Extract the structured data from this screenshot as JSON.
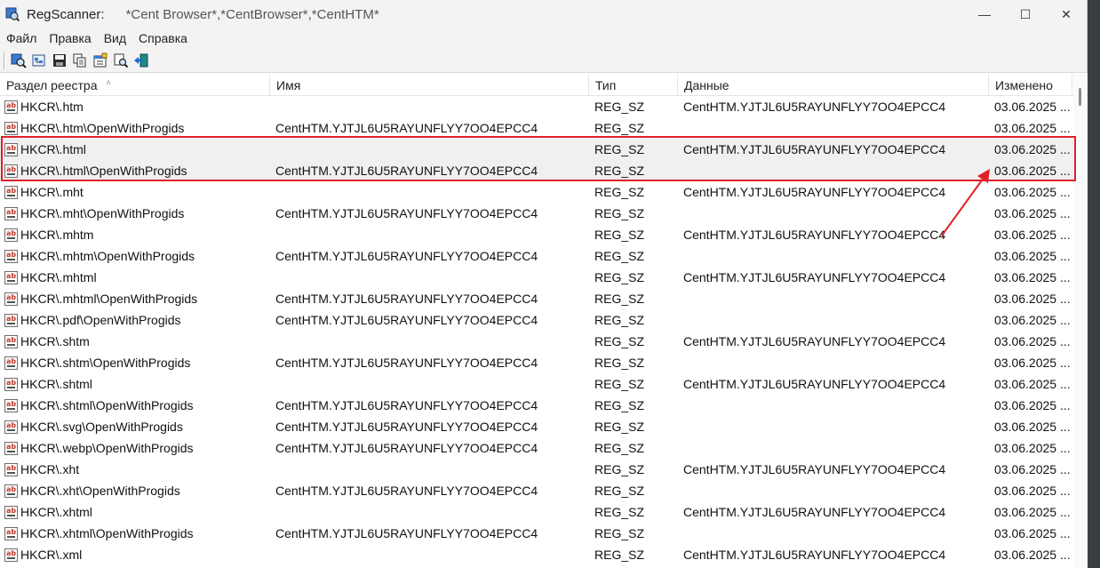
{
  "window": {
    "app_name": "RegScanner:",
    "filter": "*Cent Browser*,*CentBrowser*,*CentHTM*",
    "minimize": "—",
    "maximize": "☐",
    "close": "✕"
  },
  "menu": [
    "Файл",
    "Правка",
    "Вид",
    "Справка"
  ],
  "columns": {
    "key": "Раздел реестра",
    "name": "Имя",
    "type": "Тип",
    "data": "Данные",
    "modified": "Изменено"
  },
  "rows": [
    {
      "key": "HKCR\\.htm",
      "name": "",
      "type": "REG_SZ",
      "data": "CentHTM.YJTJL6U5RAYUNFLYY7OO4EPCC4",
      "modified": "03.06.2025 ..."
    },
    {
      "key": "HKCR\\.htm\\OpenWithProgids",
      "name": "CentHTM.YJTJL6U5RAYUNFLYY7OO4EPCC4",
      "type": "REG_SZ",
      "data": "",
      "modified": "03.06.2025 ..."
    },
    {
      "key": "HKCR\\.html",
      "name": "",
      "type": "REG_SZ",
      "data": "CentHTM.YJTJL6U5RAYUNFLYY7OO4EPCC4",
      "modified": "03.06.2025 ..."
    },
    {
      "key": "HKCR\\.html\\OpenWithProgids",
      "name": "CentHTM.YJTJL6U5RAYUNFLYY7OO4EPCC4",
      "type": "REG_SZ",
      "data": "",
      "modified": "03.06.2025 ..."
    },
    {
      "key": "HKCR\\.mht",
      "name": "",
      "type": "REG_SZ",
      "data": "CentHTM.YJTJL6U5RAYUNFLYY7OO4EPCC4",
      "modified": "03.06.2025 ..."
    },
    {
      "key": "HKCR\\.mht\\OpenWithProgids",
      "name": "CentHTM.YJTJL6U5RAYUNFLYY7OO4EPCC4",
      "type": "REG_SZ",
      "data": "",
      "modified": "03.06.2025 ..."
    },
    {
      "key": "HKCR\\.mhtm",
      "name": "",
      "type": "REG_SZ",
      "data": "CentHTM.YJTJL6U5RAYUNFLYY7OO4EPCC4",
      "modified": "03.06.2025 ..."
    },
    {
      "key": "HKCR\\.mhtm\\OpenWithProgids",
      "name": "CentHTM.YJTJL6U5RAYUNFLYY7OO4EPCC4",
      "type": "REG_SZ",
      "data": "",
      "modified": "03.06.2025 ..."
    },
    {
      "key": "HKCR\\.mhtml",
      "name": "",
      "type": "REG_SZ",
      "data": "CentHTM.YJTJL6U5RAYUNFLYY7OO4EPCC4",
      "modified": "03.06.2025 ..."
    },
    {
      "key": "HKCR\\.mhtml\\OpenWithProgids",
      "name": "CentHTM.YJTJL6U5RAYUNFLYY7OO4EPCC4",
      "type": "REG_SZ",
      "data": "",
      "modified": "03.06.2025 ..."
    },
    {
      "key": "HKCR\\.pdf\\OpenWithProgids",
      "name": "CentHTM.YJTJL6U5RAYUNFLYY7OO4EPCC4",
      "type": "REG_SZ",
      "data": "",
      "modified": "03.06.2025 ..."
    },
    {
      "key": "HKCR\\.shtm",
      "name": "",
      "type": "REG_SZ",
      "data": "CentHTM.YJTJL6U5RAYUNFLYY7OO4EPCC4",
      "modified": "03.06.2025 ..."
    },
    {
      "key": "HKCR\\.shtm\\OpenWithProgids",
      "name": "CentHTM.YJTJL6U5RAYUNFLYY7OO4EPCC4",
      "type": "REG_SZ",
      "data": "",
      "modified": "03.06.2025 ..."
    },
    {
      "key": "HKCR\\.shtml",
      "name": "",
      "type": "REG_SZ",
      "data": "CentHTM.YJTJL6U5RAYUNFLYY7OO4EPCC4",
      "modified": "03.06.2025 ..."
    },
    {
      "key": "HKCR\\.shtml\\OpenWithProgids",
      "name": "CentHTM.YJTJL6U5RAYUNFLYY7OO4EPCC4",
      "type": "REG_SZ",
      "data": "",
      "modified": "03.06.2025 ..."
    },
    {
      "key": "HKCR\\.svg\\OpenWithProgids",
      "name": "CentHTM.YJTJL6U5RAYUNFLYY7OO4EPCC4",
      "type": "REG_SZ",
      "data": "",
      "modified": "03.06.2025 ..."
    },
    {
      "key": "HKCR\\.webp\\OpenWithProgids",
      "name": "CentHTM.YJTJL6U5RAYUNFLYY7OO4EPCC4",
      "type": "REG_SZ",
      "data": "",
      "modified": "03.06.2025 ..."
    },
    {
      "key": "HKCR\\.xht",
      "name": "",
      "type": "REG_SZ",
      "data": "CentHTM.YJTJL6U5RAYUNFLYY7OO4EPCC4",
      "modified": "03.06.2025 ..."
    },
    {
      "key": "HKCR\\.xht\\OpenWithProgids",
      "name": "CentHTM.YJTJL6U5RAYUNFLYY7OO4EPCC4",
      "type": "REG_SZ",
      "data": "",
      "modified": "03.06.2025 ..."
    },
    {
      "key": "HKCR\\.xhtml",
      "name": "",
      "type": "REG_SZ",
      "data": "CentHTM.YJTJL6U5RAYUNFLYY7OO4EPCC4",
      "modified": "03.06.2025 ..."
    },
    {
      "key": "HKCR\\.xhtml\\OpenWithProgids",
      "name": "CentHTM.YJTJL6U5RAYUNFLYY7OO4EPCC4",
      "type": "REG_SZ",
      "data": "",
      "modified": "03.06.2025 ..."
    },
    {
      "key": "HKCR\\.xml",
      "name": "",
      "type": "REG_SZ",
      "data": "CentHTM.YJTJL6U5RAYUNFLYY7OO4EPCC4",
      "modified": "03.06.2025 ..."
    }
  ],
  "selected_row": 2,
  "annotation_color": "#e0202a"
}
